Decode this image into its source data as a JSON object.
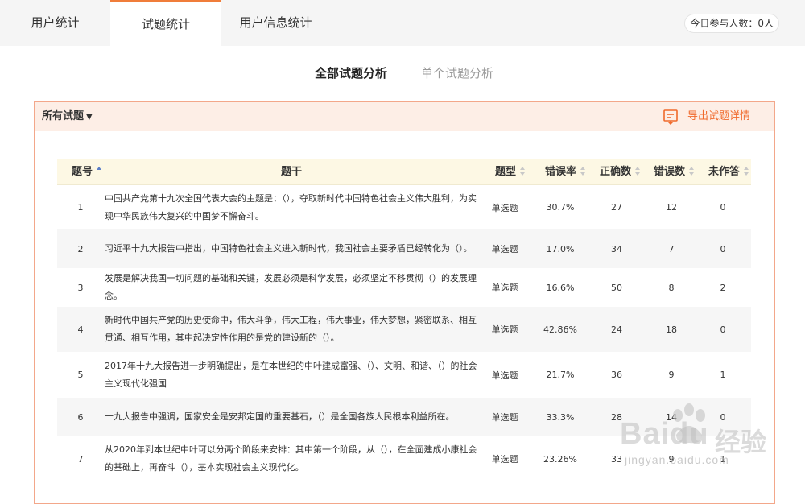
{
  "tabs": [
    {
      "label": "用户统计",
      "active": false
    },
    {
      "label": "试题统计",
      "active": true
    },
    {
      "label": "用户信息统计",
      "active": false
    }
  ],
  "today_participants": "今日参与人数：0人",
  "subtabs": {
    "all": "全部试题分析",
    "single": "单个试题分析"
  },
  "panel": {
    "filter_label": "所有试题",
    "filter_caret": "▼",
    "export_label": "导出试题详情"
  },
  "table": {
    "headers": {
      "no": "题号",
      "stem": "题干",
      "type": "题型",
      "error_rate": "错误率",
      "correct": "正确数",
      "wrong": "错误数",
      "unanswered": "未作答"
    },
    "rows": [
      {
        "no": "1",
        "stem": "中国共产党第十九次全国代表大会的主题是：（），夺取新时代中国特色社会主义伟大胜利，为实现中华民族伟大复兴的中国梦不懈奋斗。",
        "type": "单选题",
        "error_rate": "30.7%",
        "correct": "27",
        "wrong": "12",
        "unanswered": "0"
      },
      {
        "no": "2",
        "stem": "习近平十九大报告中指出，中国特色社会主义进入新时代，我国社会主要矛盾已经转化为（）。",
        "type": "单选题",
        "error_rate": "17.0%",
        "correct": "34",
        "wrong": "7",
        "unanswered": "0"
      },
      {
        "no": "3",
        "stem": "发展是解决我国一切问题的基础和关键，发展必须是科学发展，必须坚定不移贯彻（）的发展理念。",
        "type": "单选题",
        "error_rate": "16.6%",
        "correct": "50",
        "wrong": "8",
        "unanswered": "2"
      },
      {
        "no": "4",
        "stem": "新时代中国共产党的历史使命中，伟大斗争，伟大工程，伟大事业，伟大梦想，紧密联系、相互贯通、相互作用，其中起决定性作用的是党的建设新的（）。",
        "type": "单选题",
        "error_rate": "42.86%",
        "correct": "24",
        "wrong": "18",
        "unanswered": "0"
      },
      {
        "no": "5",
        "stem": "2017年十九大报告进一步明确提出，是在本世纪的中叶建成富强、（）、文明、和谐、（）的社会主义现代化强国",
        "type": "单选题",
        "error_rate": "21.7%",
        "correct": "36",
        "wrong": "9",
        "unanswered": "1"
      },
      {
        "no": "6",
        "stem": "十九大报告中强调，国家安全是安邦定国的重要基石，（）是全国各族人民根本利益所在。",
        "type": "单选题",
        "error_rate": "33.3%",
        "correct": "28",
        "wrong": "14",
        "unanswered": "0"
      },
      {
        "no": "7",
        "stem": "从2020年到本世纪中叶可以分两个阶段来安排：其中第一个阶段，从（），在全面建成小康社会的基础上，再奋斗（），基本实现社会主义现代化。",
        "type": "单选题",
        "error_rate": "23.26%",
        "correct": "33",
        "wrong": "9",
        "unanswered": "1"
      }
    ]
  },
  "watermark": {
    "logo": "Baidu",
    "cn": "经验",
    "url": "jingyan.baidu.com"
  },
  "colors": {
    "accent": "#f07d3a",
    "export": "#f06a2c",
    "panel_border": "#f3a78a",
    "panel_head": "#fdeee6",
    "table_head": "#fdf8e4",
    "sort_active": "#5b7ec6"
  }
}
